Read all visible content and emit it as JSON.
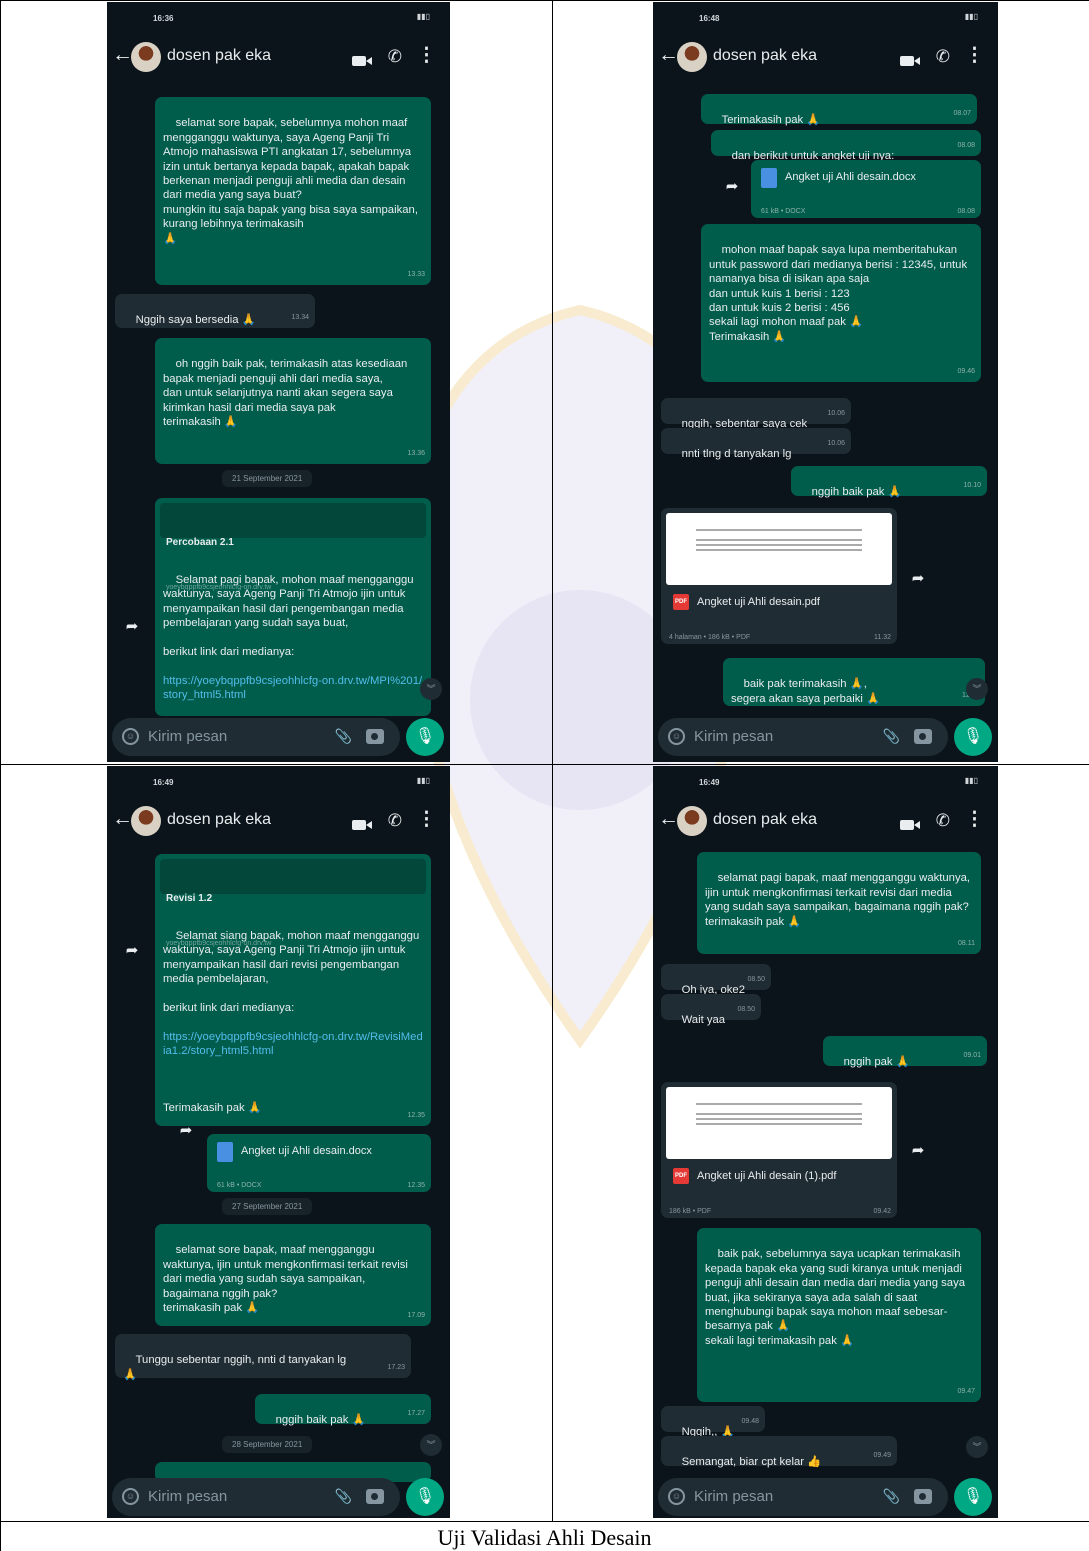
{
  "caption": "Uji Validasi Ahli Desain",
  "chat_header": {
    "contact_name": "dosen pak eka",
    "input_placeholder": "Kirim pesan"
  },
  "screens": [
    {
      "time": "16:36",
      "messages": [
        {
          "dir": "out",
          "text": "selamat sore bapak, sebelumnya mohon maaf mengganggu waktunya, saya Ageng Panji Tri Atmojo mahasiswa PTI angkatan 17, sebelumnya izin untuk bertanya kepada bapak, apakah bapak berkenan menjadi penguji ahli media dan desain dari media yang saya buat?\nmungkin itu saja bapak yang bisa saya sampaikan, kurang lebihnya terimakasih\n🙏",
          "time": "13.33"
        },
        {
          "dir": "in",
          "text": "Nggih saya bersedia 🙏",
          "time": "13.34"
        },
        {
          "dir": "out",
          "text": "oh nggih baik pak, terimakasih atas kesediaan bapak menjadi penguji ahli dari media saya,\ndan untuk selanjutnya nanti akan segera saya kirimkan hasil dari media saya pak\nterimakasih 🙏",
          "time": "13.36"
        },
        {
          "dir": "date",
          "text": "21 September 2021"
        },
        {
          "dir": "out",
          "preview_title": "Percobaan 2.1",
          "preview_url": "yoeybqppfb9csjeohhlcfg-on.drv.tw",
          "text": "Selamat pagi bapak, mohon maaf mengganggu waktunya, saya Ageng Panji Tri Atmojo ijin untuk menyampaikan hasil dari pengembangan media pembelajaran yang sudah saya buat,\n\nberikut link dari medianya:",
          "link": "https://yoeybqppfb9csjeohhlcfg-on.drv.tw/MPI%201/story_html5.html"
        }
      ]
    },
    {
      "time": "16:48",
      "messages": [
        {
          "dir": "out",
          "text": "Terimakasih pak 🙏",
          "time": "08.07"
        },
        {
          "dir": "out",
          "text": "dan berikut untuk angket uji nya:",
          "time": "08.08"
        },
        {
          "dir": "file",
          "name": "Angket uji Ahli desain.docx",
          "meta": "61 kB • DOCX",
          "time": "08.08"
        },
        {
          "dir": "out",
          "text": "mohon maaf bapak saya lupa memberitahukan untuk password dari medianya berisi : 12345, untuk namanya bisa di isikan apa saja\ndan untuk kuis 1 berisi : 123\ndan untuk kuis 2 berisi : 456\nsekali lagi mohon maaf pak 🙏\nTerimakasih 🙏",
          "time": "09.46"
        },
        {
          "dir": "in",
          "text": "nggih, sebentar saya cek",
          "time": "10.06"
        },
        {
          "dir": "in",
          "text": "nnti tlng d tanyakan lg",
          "time": "10.06"
        },
        {
          "dir": "out",
          "text": "nggih baik pak 🙏",
          "time": "10.10"
        },
        {
          "dir": "pdf",
          "name": "Angket uji Ahli desain.pdf",
          "meta": "4 halaman • 186 kB • PDF",
          "time": "11.32"
        },
        {
          "dir": "out",
          "text": "baik pak terimakasih 🙏,\nsegera akan saya perbaiki 🙏",
          "time": "12.11"
        }
      ]
    },
    {
      "time": "16:49",
      "messages": [
        {
          "dir": "out",
          "preview_title": "Revisi 1.2",
          "preview_url": "yoeybqppfb9csjeohhlcfg-on.drv.tw",
          "text": "Selamat siang bapak, mohon maaf mengganggu waktunya, saya Ageng Panji Tri Atmojo ijin untuk menyampaikan hasil dari revisi pengembangan media pembelajaran,\n\nberikut link dari medianya:",
          "link": "https://yoeybqppfb9csjeohhlcfg-on.drv.tw/RevisiMedia1.2/story_html5.html",
          "text_after": "Terimakasih pak 🙏",
          "time": "12.35"
        },
        {
          "dir": "file",
          "name": "Angket uji Ahli desain.docx",
          "meta": "61 kB • DOCX",
          "time": "12.35"
        },
        {
          "dir": "date",
          "text": "27 September 2021"
        },
        {
          "dir": "out",
          "text": "selamat sore bapak, maaf mengganggu waktunya, ijin untuk mengkonfirmasi terkait revisi dari media yang sudah saya sampaikan, bagaimana nggih pak?\nterimakasih pak 🙏",
          "time": "17.09"
        },
        {
          "dir": "in",
          "text": "Tunggu sebentar nggih, nnti d tanyakan lg\n🙏",
          "time": "17.23"
        },
        {
          "dir": "out",
          "text": "nggih baik pak 🙏",
          "time": "17.27"
        },
        {
          "dir": "date",
          "text": "28 September 2021"
        }
      ]
    },
    {
      "time": "16:49",
      "messages": [
        {
          "dir": "out",
          "text": "selamat pagi bapak, maaf mengganggu waktunya, ijin untuk mengkonfirmasi terkait revisi dari media yang sudah saya sampaikan, bagaimana nggih pak?\nterimakasih pak 🙏",
          "time": "08.11"
        },
        {
          "dir": "in",
          "text": "Oh iya, oke2",
          "time": "08.50"
        },
        {
          "dir": "in",
          "text": "Wait yaa",
          "time": "08.50"
        },
        {
          "dir": "out",
          "text": "nggih pak 🙏",
          "time": "09.01"
        },
        {
          "dir": "pdf",
          "name": "Angket uji Ahli desain (1).pdf",
          "meta": "186 kB • PDF",
          "time": "09.42"
        },
        {
          "dir": "out",
          "text": "baik pak, sebelumnya saya ucapkan terimakasih kepada bapak eka yang sudi kiranya untuk menjadi penguji ahli desain dan media dari media yang saya buat, jika sekiranya saya ada salah di saat menghubungi bapak saya mohon maaf sebesar-besarnya pak 🙏\nsekali lagi terimakasih pak 🙏",
          "time": "09.47"
        },
        {
          "dir": "in",
          "text": "Nggih,, 🙏",
          "time": "09.48"
        },
        {
          "dir": "in",
          "text": "Semangat, biar cpt kelar 👍",
          "time": "09.49"
        }
      ]
    }
  ]
}
